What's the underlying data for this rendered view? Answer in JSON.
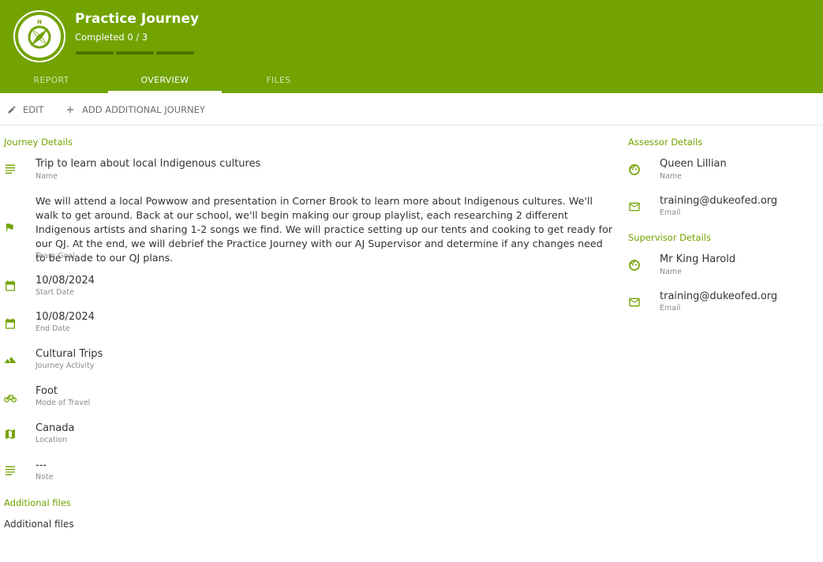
{
  "header": {
    "title": "Practice Journey",
    "completed": "Completed 0 / 3",
    "progress": {
      "completed": 0,
      "total": 3
    }
  },
  "tabs": [
    {
      "label": "REPORT",
      "active": false
    },
    {
      "label": "OVERVIEW",
      "active": true
    },
    {
      "label": "FILES",
      "active": false
    }
  ],
  "toolbar": {
    "edit_label": "EDIT",
    "add_label": "ADD ADDITIONAL JOURNEY"
  },
  "journey": {
    "section_title": "Journey Details",
    "name": {
      "value": "Trip to learn about local Indigenous cultures",
      "label": "Name",
      "icon": "notes-icon"
    },
    "team_goal": {
      "value": "We will attend a local Powwow and presentation in Corner Brook to learn more about Indigenous cultures. We'll walk to get around. Back at our school, we'll begin making our group playlist, each researching 2 different Indigenous artists and sharing 1-2 songs we find. We will practice setting up our tents and cooking to get ready for our QJ. At the end, we will debrief the Practice Journey with our AJ Supervisor and determine if any changes need to be made to our QJ plans.",
      "label": "Team Goal",
      "icon": "flag-icon"
    },
    "start_date": {
      "value": "10/08/2024",
      "label": "Start Date",
      "icon": "calendar-icon"
    },
    "end_date": {
      "value": "10/08/2024",
      "label": "End Date",
      "icon": "calendar-icon"
    },
    "activity": {
      "value": "Cultural Trips",
      "label": "Journey Activity",
      "icon": "mountain-icon"
    },
    "travel": {
      "value": "Foot",
      "label": "Mode of Travel",
      "icon": "bike-icon"
    },
    "location": {
      "value": "Canada",
      "label": "Location",
      "icon": "map-icon"
    },
    "note": {
      "value": "---",
      "label": "Note",
      "icon": "notes-icon"
    }
  },
  "files": {
    "section_title": "Additional files",
    "text": "Additional files"
  },
  "assessor": {
    "section_title": "Assessor Details",
    "name": {
      "value": "Queen Lillian",
      "label": "Name",
      "icon": "face-icon"
    },
    "email": {
      "value": "training@dukeofed.org",
      "label": "Email",
      "icon": "mail-icon"
    }
  },
  "supervisor": {
    "section_title": "Supervisor Details",
    "name": {
      "value": "Mr King Harold",
      "label": "Name",
      "icon": "face-icon"
    },
    "email": {
      "value": "training@dukeofed.org",
      "label": "Email",
      "icon": "mail-icon"
    }
  },
  "colors": {
    "brand": "#72a300",
    "progress_track": "#4f7200",
    "text": "#333333",
    "muted": "#8a8a8a"
  }
}
